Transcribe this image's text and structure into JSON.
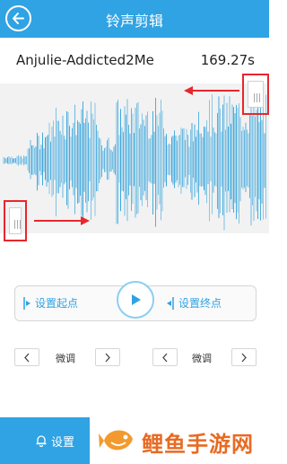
{
  "header": {
    "title": "铃声剪辑",
    "back_icon": "back-arrow-icon",
    "background": "#2fa3e3"
  },
  "song": {
    "name": "Anjulie-Addicted2Me",
    "duration": "169.27s"
  },
  "waveform": {
    "color": "#3aa6dd",
    "background": "#f2f2f2",
    "annotation_color": "#e8272c"
  },
  "controls": {
    "set_start_label": "设置起点",
    "set_end_label": "设置终点",
    "play_icon": "play-icon"
  },
  "fine_tune": {
    "left_label": "微调",
    "right_label": "微调"
  },
  "bottom": {
    "settings_label": "设置",
    "settings_icon": "bell-icon",
    "watermark_text": "鲤鱼手游网",
    "watermark_color": "#e86a23"
  }
}
